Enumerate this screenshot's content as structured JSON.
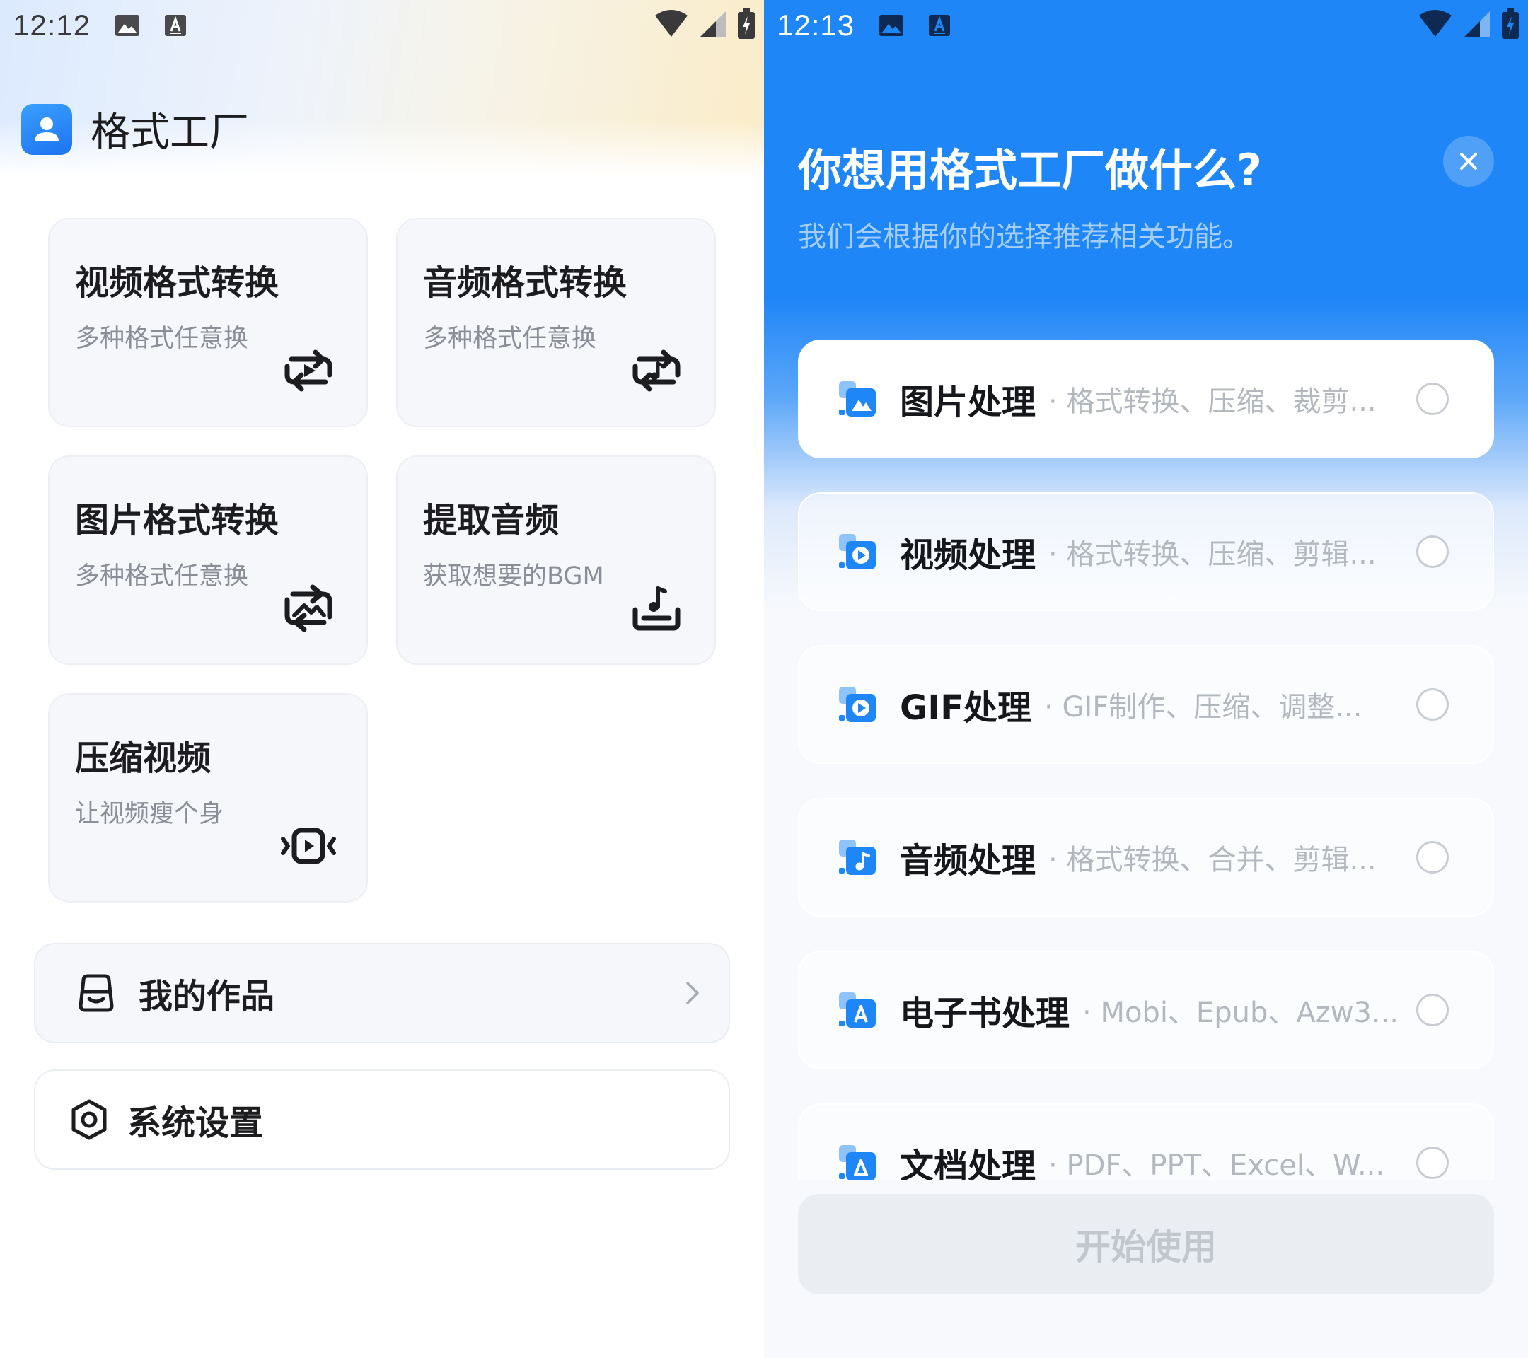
{
  "left_screen": {
    "status_bar": {
      "time": "12:12"
    },
    "app": {
      "name": "格式工厂"
    },
    "cards": [
      {
        "title": "视频格式转换",
        "subtitle": "多种格式任意换",
        "icon": "video-convert-icon"
      },
      {
        "title": "音频格式转换",
        "subtitle": "多种格式任意换",
        "icon": "audio-convert-icon"
      },
      {
        "title": "图片格式转换",
        "subtitle": "多种格式任意换",
        "icon": "image-convert-icon"
      },
      {
        "title": "提取音频",
        "subtitle": "获取想要的BGM",
        "icon": "extract-audio-icon"
      },
      {
        "title": "压缩视频",
        "subtitle": "让视频瘦个身",
        "icon": "compress-video-icon"
      }
    ],
    "rows": {
      "my_works": "我的作品",
      "settings": "系统设置"
    }
  },
  "right_screen": {
    "status_bar": {
      "time": "12:13"
    },
    "question": "你想用格式工厂做什么?",
    "hint": "我们会根据你的选择推荐相关功能。",
    "options": [
      {
        "title": "图片处理",
        "desc": "· 格式转换、压缩、裁剪...",
        "icon": "image-icon"
      },
      {
        "title": "视频处理",
        "desc": "· 格式转换、压缩、剪辑...",
        "icon": "video-icon"
      },
      {
        "title": "GIF处理",
        "desc": "· GIF制作、压缩、调整...",
        "icon": "gif-icon"
      },
      {
        "title": "音频处理",
        "desc": "· 格式转换、合并、剪辑...",
        "icon": "audio-icon"
      },
      {
        "title": "电子书处理",
        "desc": "· Mobi、Epub、Azw3...",
        "icon": "ebook-icon"
      },
      {
        "title": "文档处理",
        "desc": "· PDF、PPT、Excel、W...",
        "icon": "document-icon"
      }
    ],
    "start_button": "开始使用"
  },
  "colors": {
    "primary_blue": "#1f86f7",
    "card_bg": "#f5f7fb",
    "muted_text": "#8a8e96",
    "disabled_text": "#c2c6cd"
  }
}
